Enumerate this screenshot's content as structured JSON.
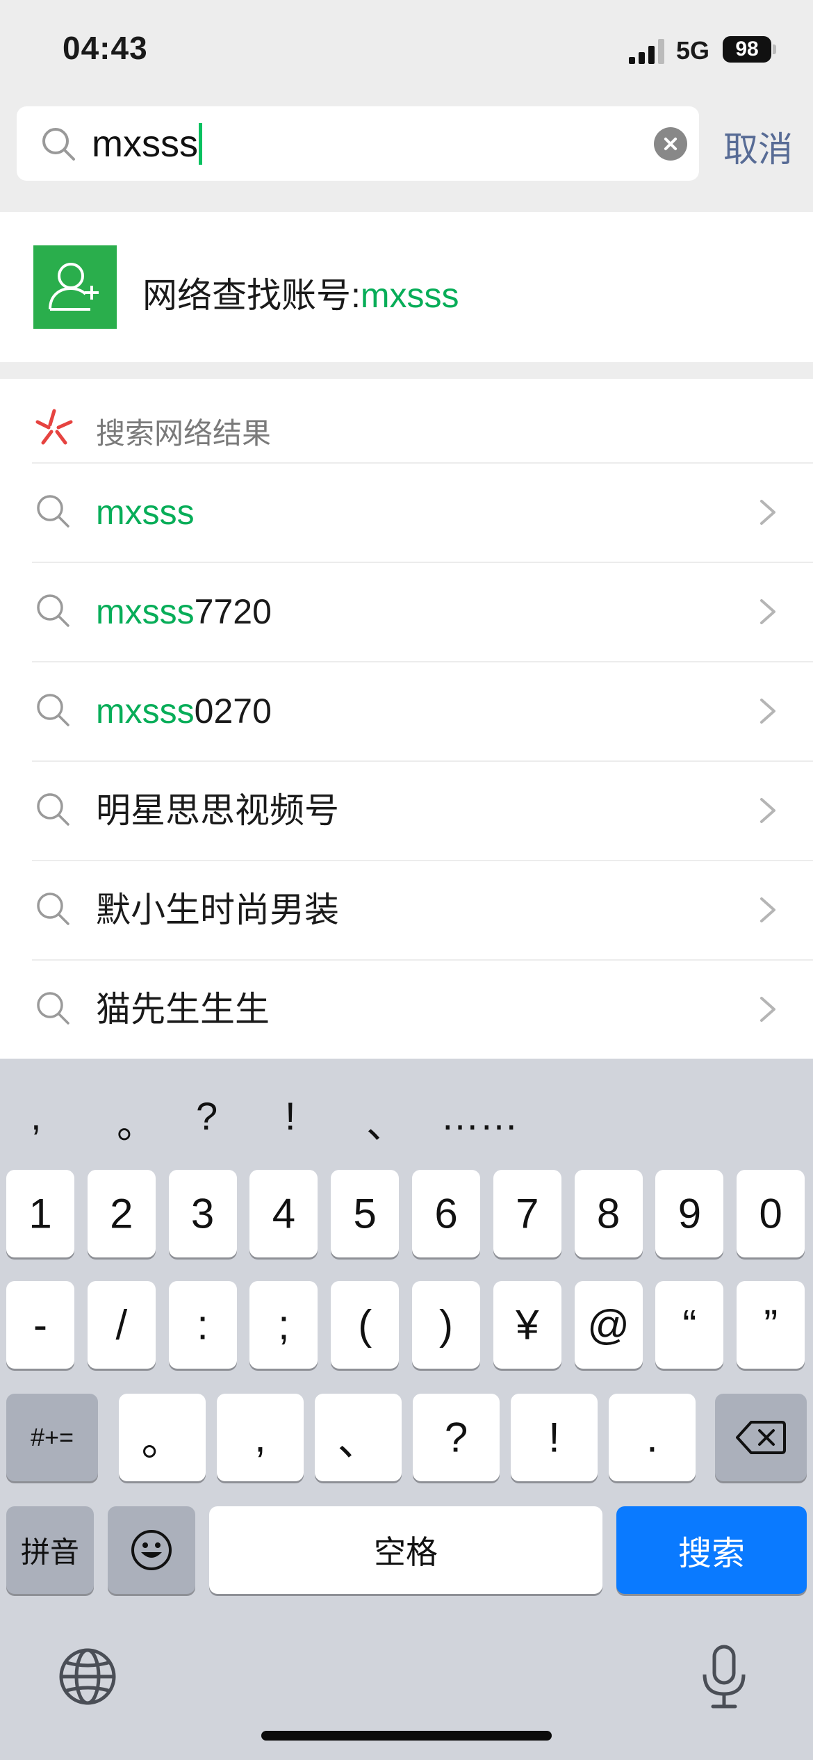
{
  "status_bar": {
    "time": "04:43",
    "network": "5G",
    "battery": "98"
  },
  "search": {
    "query": "mxsss",
    "cancel_label": "取消"
  },
  "account_search": {
    "prefix": "网络查找账号:",
    "query": "mxsss"
  },
  "results": {
    "title": "搜索网络结果",
    "items": [
      {
        "highlight": "mxsss",
        "rest": ""
      },
      {
        "highlight": "mxsss",
        "rest": "7720"
      },
      {
        "highlight": "mxsss",
        "rest": "0270"
      },
      {
        "highlight": "",
        "rest": "明星思思视频号"
      },
      {
        "highlight": "",
        "rest": "默小生时尚男装"
      },
      {
        "highlight": "",
        "rest": "猫先生生生"
      }
    ]
  },
  "keyboard": {
    "punctuation": [
      ",",
      "。",
      "?",
      "!",
      "、",
      "……"
    ],
    "row1": [
      "1",
      "2",
      "3",
      "4",
      "5",
      "6",
      "7",
      "8",
      "9",
      "0"
    ],
    "row2": [
      "-",
      "/",
      ":",
      ";",
      "(",
      ")",
      "¥",
      "@",
      "“",
      "”"
    ],
    "row3_symbols_label": "#+=",
    "row3": [
      "。",
      ",",
      "、",
      "?",
      "!",
      "."
    ],
    "pinyin_label": "拼音",
    "space_label": "空格",
    "search_label": "搜索"
  },
  "colors": {
    "accent_green": "#07ad58",
    "link_blue": "#576b95",
    "key_blue": "#0a7aff",
    "account_icon_green": "#2aae4c"
  },
  "icons": [
    "search-icon",
    "clear-icon",
    "add-contact-icon",
    "network-search-logo",
    "chevron-right-icon",
    "backspace-icon",
    "emoji-icon",
    "globe-icon",
    "microphone-icon",
    "cellular-signal-icon",
    "battery-icon"
  ]
}
